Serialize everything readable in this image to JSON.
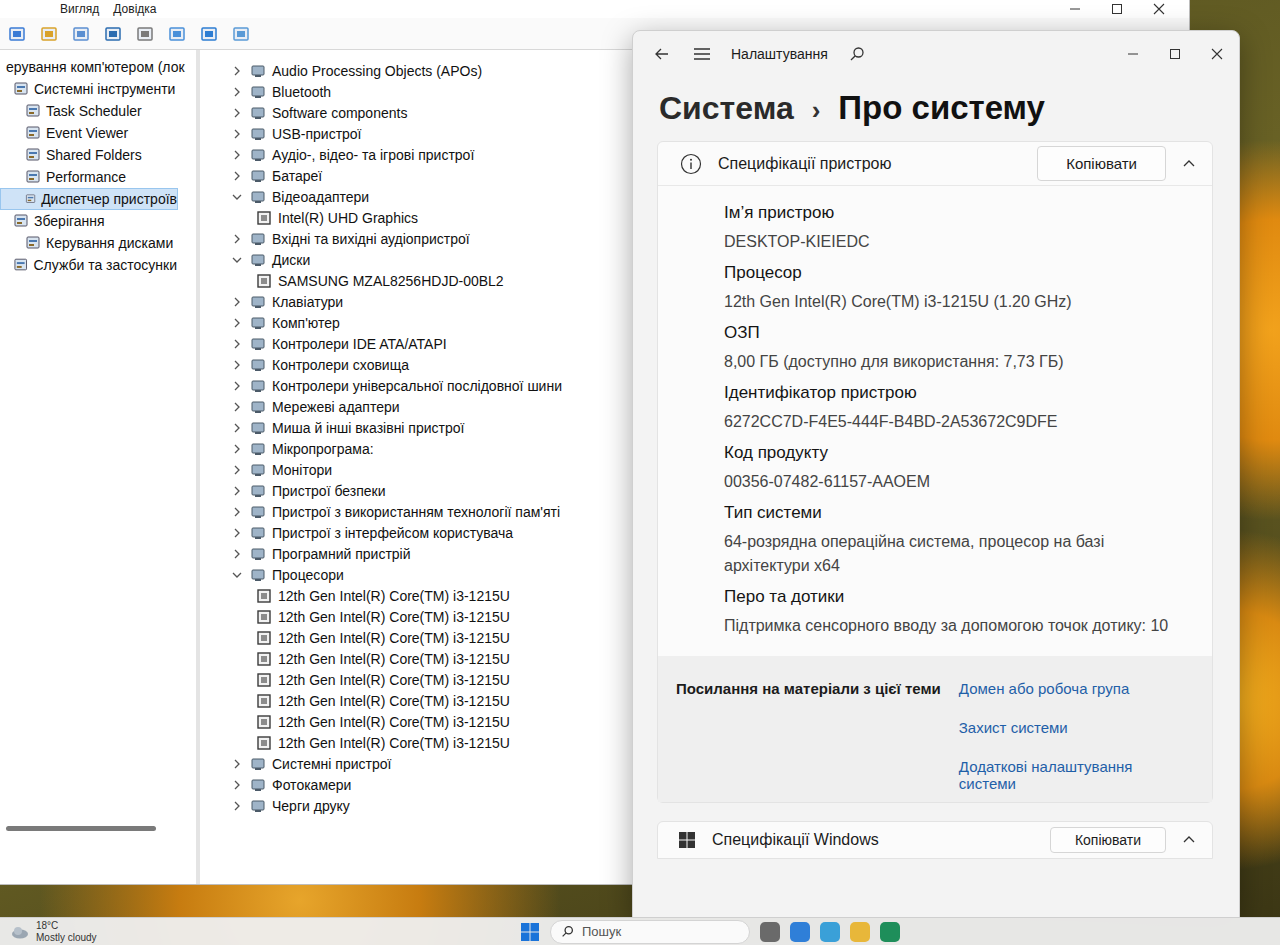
{
  "management_window": {
    "menu": [
      "Вигляд",
      "Довідка"
    ],
    "console_tree": [
      {
        "label": "ерування комп'ютером (лок",
        "selected": false,
        "children": [
          {
            "label": "Системні інструменти",
            "selected": false,
            "children": [
              {
                "label": "Task Scheduler",
                "selected": false,
                "children": []
              },
              {
                "label": "Event Viewer",
                "selected": false,
                "children": []
              },
              {
                "label": "Shared Folders",
                "selected": false,
                "children": []
              },
              {
                "label": "Performance",
                "selected": false,
                "children": []
              },
              {
                "label": "Диспетчер пристроїв",
                "selected": true,
                "children": []
              }
            ]
          },
          {
            "label": "Зберігання",
            "selected": false,
            "children": [
              {
                "label": "Керування дисками",
                "selected": false,
                "children": []
              }
            ]
          },
          {
            "label": "Служби та застосунки",
            "selected": false,
            "children": []
          }
        ]
      }
    ],
    "device_tree": [
      {
        "label": "Audio Processing Objects (APOs)",
        "expanded": false,
        "children": []
      },
      {
        "label": "Bluetooth",
        "expanded": false,
        "children": []
      },
      {
        "label": "Software components",
        "expanded": false,
        "children": []
      },
      {
        "label": "USB-пристрої",
        "expanded": false,
        "children": []
      },
      {
        "label": "Аудіо-, відео- та ігрові пристрої",
        "expanded": false,
        "children": []
      },
      {
        "label": "Батареї",
        "expanded": false,
        "children": []
      },
      {
        "label": "Відеоадаптери",
        "expanded": true,
        "children": [
          "Intel(R) UHD Graphics"
        ]
      },
      {
        "label": "Вхідні та вихідні аудіопристрої",
        "expanded": false,
        "children": []
      },
      {
        "label": "Диски",
        "expanded": true,
        "children": [
          "SAMSUNG MZAL8256HDJD-00BL2"
        ]
      },
      {
        "label": "Клавіатури",
        "expanded": false,
        "children": []
      },
      {
        "label": "Комп'ютер",
        "expanded": false,
        "children": []
      },
      {
        "label": "Контролери IDE ATA/ATAPI",
        "expanded": false,
        "children": []
      },
      {
        "label": "Контролери сховища",
        "expanded": false,
        "children": []
      },
      {
        "label": "Контролери універсальної послідовної шини",
        "expanded": false,
        "children": []
      },
      {
        "label": "Мережеві адаптери",
        "expanded": false,
        "children": []
      },
      {
        "label": "Миша й інші вказівні пристрої",
        "expanded": false,
        "children": []
      },
      {
        "label": "Мікропрограма:",
        "expanded": false,
        "children": []
      },
      {
        "label": "Монітори",
        "expanded": false,
        "children": []
      },
      {
        "label": "Пристрої безпеки",
        "expanded": false,
        "children": []
      },
      {
        "label": "Пристрої з використанням технології пам'яті",
        "expanded": false,
        "children": []
      },
      {
        "label": "Пристрої з інтерфейсом користувача",
        "expanded": false,
        "children": []
      },
      {
        "label": "Програмний пристрій",
        "expanded": false,
        "children": []
      },
      {
        "label": "Процесори",
        "expanded": true,
        "children": [
          "12th Gen Intel(R) Core(TM) i3-1215U",
          "12th Gen Intel(R) Core(TM) i3-1215U",
          "12th Gen Intel(R) Core(TM) i3-1215U",
          "12th Gen Intel(R) Core(TM) i3-1215U",
          "12th Gen Intel(R) Core(TM) i3-1215U",
          "12th Gen Intel(R) Core(TM) i3-1215U",
          "12th Gen Intel(R) Core(TM) i3-1215U",
          "12th Gen Intel(R) Core(TM) i3-1215U"
        ]
      },
      {
        "label": "Системні пристрої",
        "expanded": false,
        "children": []
      },
      {
        "label": "Фотокамери",
        "expanded": false,
        "children": []
      },
      {
        "label": "Черги друку",
        "expanded": false,
        "children": []
      }
    ]
  },
  "settings_window": {
    "app_title": "Налаштування",
    "breadcrumb": {
      "parent": "Система",
      "separator": "›",
      "current": "Про систему"
    },
    "device_specs": {
      "title": "Специфікації пристрою",
      "copy_button": "Копіювати",
      "expanded": true,
      "fields": [
        {
          "label": "Ім’я пристрою",
          "value": "DESKTOP-KIEIEDC"
        },
        {
          "label": "Процесор",
          "value": "12th Gen Intel(R) Core(TM) i3-1215U (1.20 GHz)"
        },
        {
          "label": "ОЗП",
          "value": "8,00 ГБ (доступно для використання: 7,73 ГБ)"
        },
        {
          "label": "Ідентифікатор пристрою",
          "value": "6272CC7D-F4E5-444F-B4BD-2A53672C9DFE"
        },
        {
          "label": "Код продукту",
          "value": "00356-07482-61157-AAOEM"
        },
        {
          "label": "Тип системи",
          "value": "64-розрядна операційна система, процесор на базі архітектури x64"
        },
        {
          "label": "Перо та дотики",
          "value": "Підтримка сенсорного вводу за допомогою точок дотику: 10"
        }
      ]
    },
    "related": {
      "title": "Посилання на матеріали з цієї теми",
      "links": [
        "Домен або робоча група",
        "Захист системи",
        "Додаткові налаштування системи"
      ]
    },
    "windows_specs": {
      "title": "Специфікації Windows",
      "copy_button": "Копіювати",
      "expanded": true
    }
  },
  "taskbar": {
    "weather": {
      "temperature": "18°C",
      "condition": "Mostly cloudy"
    },
    "search": {
      "placeholder": "Пошук"
    }
  }
}
